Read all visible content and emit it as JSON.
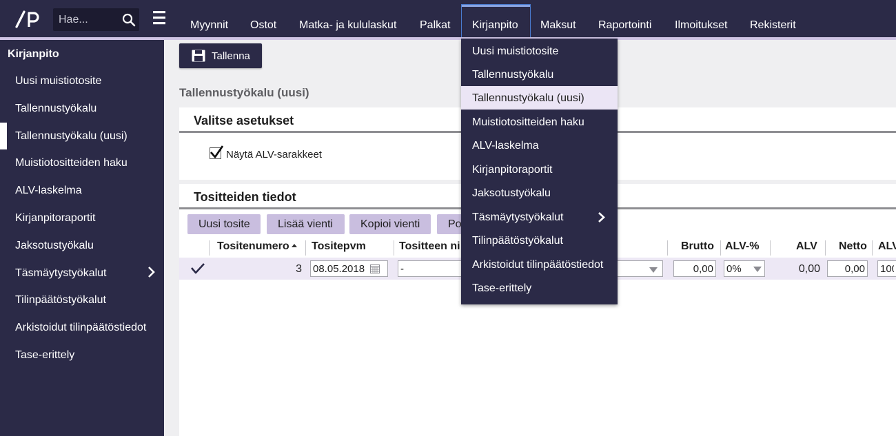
{
  "colors": {
    "topbar": "#2b2a47",
    "accent_strip": "#cfc4e4",
    "main_bg": "#efeff1",
    "tool_button": "#c9bedf",
    "selected_row": "#ede8f5"
  },
  "header": {
    "search_placeholder": "Hae...",
    "nav": [
      {
        "label": "Myynnit"
      },
      {
        "label": "Ostot"
      },
      {
        "label": "Matka- ja kululaskut"
      },
      {
        "label": "Palkat"
      },
      {
        "label": "Kirjanpito",
        "active": true
      },
      {
        "label": "Maksut"
      },
      {
        "label": "Raportointi"
      },
      {
        "label": "Ilmoitukset"
      },
      {
        "label": "Rekisterit"
      }
    ]
  },
  "sidebar": {
    "title": "Kirjanpito",
    "items": [
      {
        "label": "Uusi muistiotosite"
      },
      {
        "label": "Tallennustyökalu"
      },
      {
        "label": "Tallennustyökalu (uusi)",
        "active": true
      },
      {
        "label": "Muistiotositteiden haku"
      },
      {
        "label": "ALV-laskelma"
      },
      {
        "label": "Kirjanpitoraportit"
      },
      {
        "label": "Jaksotustyökalu"
      },
      {
        "label": "Täsmäytystyökalut",
        "has_submenu": true
      },
      {
        "label": "Tilinpäätöstyökalut"
      },
      {
        "label": "Arkistoidut tilinpäätöstiedot"
      },
      {
        "label": "Tase-erittely"
      }
    ]
  },
  "toolbar": {
    "save_label": "Tallenna"
  },
  "main": {
    "page_title": "Tallennustyökalu (uusi)",
    "settings": {
      "title": "Valitse asetukset",
      "checkbox_label": "Näytä ALV-sarakkeet",
      "checked": true
    },
    "vouchers": {
      "title": "Tositteiden tiedot",
      "buttons": {
        "new": "Uusi tosite",
        "add": "Lisää vienti",
        "copy": "Kopioi vienti",
        "remove": "Po"
      },
      "columns": {
        "number": "Tositenumero",
        "date": "Tositepvm",
        "name": "Tositteen ni",
        "gross": "Brutto",
        "vat_pct": "ALV-%",
        "vat": "ALV",
        "net": "Netto",
        "vat_end": "ALV"
      },
      "row": {
        "number": "3",
        "date": "08.05.2018",
        "name": "-",
        "gross": "0,00",
        "vat_pct": "0%",
        "vat": "0,00",
        "net": "0,00",
        "last": "100"
      }
    }
  },
  "dropdown": {
    "items": [
      {
        "label": "Uusi muistiotosite"
      },
      {
        "label": "Tallennustyökalu"
      },
      {
        "label": "Tallennustyökalu (uusi)",
        "selected": true
      },
      {
        "label": "Muistiotositteiden haku"
      },
      {
        "label": "ALV-laskelma"
      },
      {
        "label": "Kirjanpitoraportit"
      },
      {
        "label": "Jaksotustyökalu"
      },
      {
        "label": "Täsmäytystyökalut",
        "has_submenu": true
      },
      {
        "label": "Tilinpäätöstyökalut"
      },
      {
        "label": "Arkistoidut tilinpäätöstiedot"
      },
      {
        "label": "Tase-erittely"
      }
    ]
  }
}
